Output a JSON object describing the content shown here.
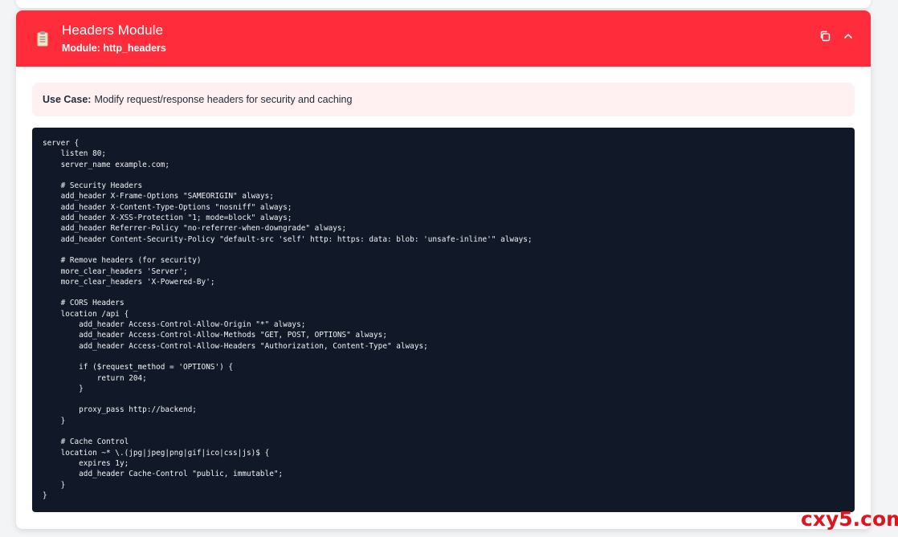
{
  "module": {
    "title": "Headers Module",
    "subtitle": "Module: http_headers",
    "accent_color": "#ff2d3b",
    "icon": "document-icon",
    "actions": {
      "copy_icon": "copy-icon",
      "collapse_icon": "chevron-up-icon"
    }
  },
  "use_case": {
    "label": "Use Case:",
    "text": "Modify request/response headers for security and caching"
  },
  "code": {
    "language": "nginx",
    "content": "server {\n    listen 80;\n    server_name example.com;\n\n    # Security Headers\n    add_header X-Frame-Options \"SAMEORIGIN\" always;\n    add_header X-Content-Type-Options \"nosniff\" always;\n    add_header X-XSS-Protection \"1; mode=block\" always;\n    add_header Referrer-Policy \"no-referrer-when-downgrade\" always;\n    add_header Content-Security-Policy \"default-src 'self' http: https: data: blob: 'unsafe-inline'\" always;\n\n    # Remove headers (for security)\n    more_clear_headers 'Server';\n    more_clear_headers 'X-Powered-By';\n\n    # CORS Headers\n    location /api {\n        add_header Access-Control-Allow-Origin \"*\" always;\n        add_header Access-Control-Allow-Methods \"GET, POST, OPTIONS\" always;\n        add_header Access-Control-Allow-Headers \"Authorization, Content-Type\" always;\n\n        if ($request_method = 'OPTIONS') {\n            return 204;\n        }\n\n        proxy_pass http://backend;\n    }\n\n    # Cache Control\n    location ~* \\.(jpg|jpeg|png|gif|ico|css|js)$ {\n        expires 1y;\n        add_header Cache-Control \"public, immutable\";\n    }\n}"
  },
  "watermark": {
    "text": "cxy5.com",
    "color": "#e0141e"
  }
}
